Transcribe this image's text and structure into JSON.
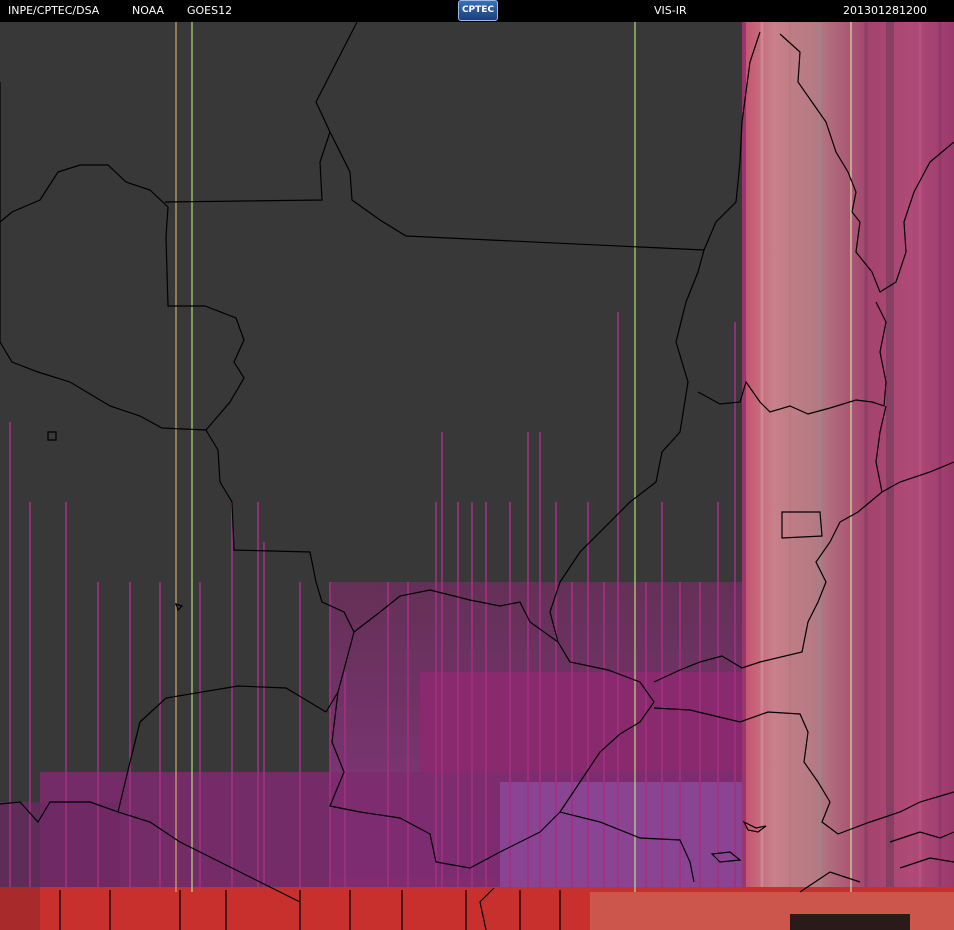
{
  "header": {
    "source": "INPE/CPTEC/DSA",
    "agency": "NOAA",
    "satellite": "GOES12",
    "logo_text": "CPTEC",
    "channel": "VIS-IR",
    "timestamp": "201301281200"
  },
  "colors": {
    "background_land": "#383838",
    "artifact_magenta": "#8a2a6e",
    "artifact_red": "#c8302e",
    "artifact_pink": "#c86e8c",
    "border_lines": "#000000",
    "grid_lines": "#d8ff90"
  }
}
